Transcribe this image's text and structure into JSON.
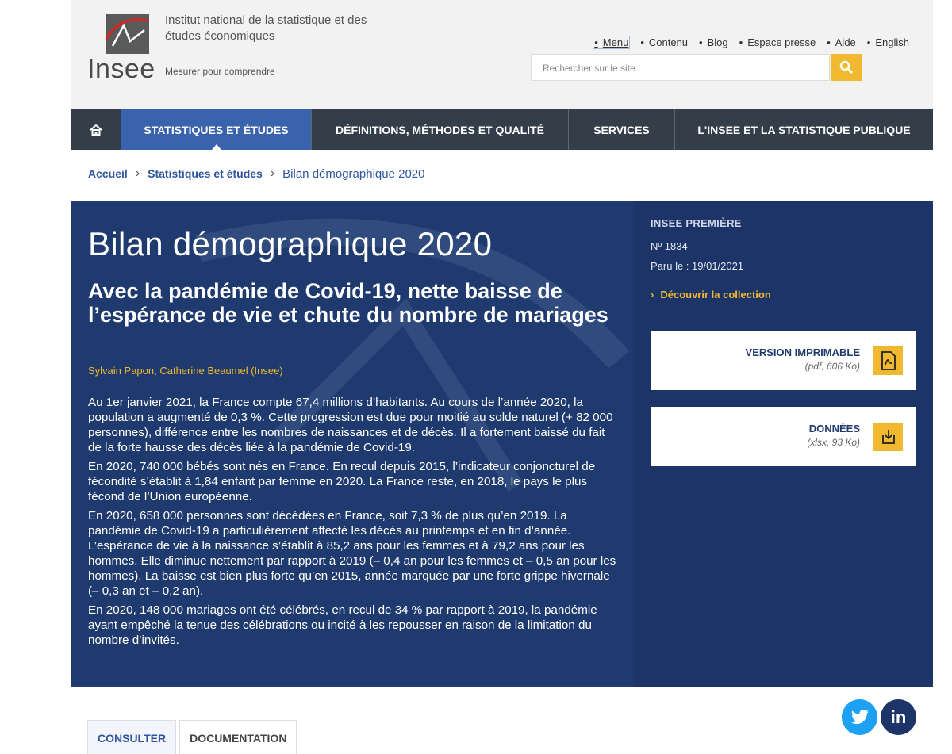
{
  "header": {
    "logo_text": "Insee",
    "institution": "Institut national de la statistique et des études économiques",
    "tagline": "Mesurer pour comprendre",
    "top_links": [
      "Menu",
      "Contenu",
      "Blog",
      "Espace presse",
      "Aide",
      "English"
    ],
    "search_placeholder": "Rechercher sur le site"
  },
  "nav": {
    "items": [
      "STATISTIQUES ET ÉTUDES",
      "DÉFINITIONS, MÉTHODES ET QUALITÉ",
      "SERVICES",
      "L'INSEE ET LA STATISTIQUE PUBLIQUE"
    ]
  },
  "breadcrumb": {
    "home": "Accueil",
    "section": "Statistiques et études",
    "current": "Bilan démographique 2020"
  },
  "article": {
    "title": "Bilan démographique 2020",
    "subtitle": "Avec la pandémie de Covid-19, nette baisse de l’espérance de vie et chute du nombre de mariages",
    "authors": "Sylvain Papon, Catherine Beaumel (Insee)",
    "paragraphs": [
      "Au 1er janvier 2021, la France compte 67,4 millions d’habitants. Au cours de l’année 2020, la population a augmenté de 0,3 %. Cette progression est due pour moitié au solde naturel (+ 82 000 personnes), différence entre les nombres de naissances et de décès. Il a fortement baissé du fait de la forte hausse des décès liée à la pandémie de Covid-19.",
      "En 2020, 740 000 bébés sont nés en France. En recul depuis 2015, l’indicateur conjoncturel de fécondité s’établit à 1,84 enfant par femme en 2020. La France reste, en 2018, le pays le plus fécond de l’Union européenne.",
      "En 2020, 658 000 personnes sont décédées en France, soit 7,3 % de plus qu’en 2019. La pandémie de Covid-19 a particulièrement affecté les décès au printemps et en fin d’année. L’espérance de vie à la naissance s’établit à 85,2 ans pour les femmes et à 79,2 ans pour les hommes. Elle diminue nettement par rapport à 2019 (– 0,4 an pour les femmes et – 0,5 an pour les hommes). La baisse est bien plus forte qu’en 2015, année marquée par une forte grippe hivernale (– 0,3 an et – 0,2 an).",
      "En 2020, 148 000 mariages ont été célébrés, en recul de 34 % par rapport à 2019, la pandémie ayant empêché la tenue des célébrations ou incité à les repousser en raison de la limitation du nombre d’invités."
    ]
  },
  "side": {
    "category": "INSEE PREMIÈRE",
    "number": "Nº 1834",
    "published": "Paru le : 19/01/2021",
    "collection_link": "Découvrir la collection",
    "print_title": "VERSION IMPRIMABLE",
    "print_sub": "(pdf, 606 Ko)",
    "data_title": "DONNÉES",
    "data_sub": "(xlsx, 93 Ko)"
  },
  "social": {
    "linkedin_label": "in"
  },
  "tabs": [
    "CONSULTER",
    "DOCUMENTATION"
  ],
  "colors": {
    "nav_bg": "#333e48",
    "nav_active": "#3a63ad",
    "hero_bg": "#1f3a6e",
    "accent": "#f1b92f",
    "link": "#2d55a0"
  }
}
